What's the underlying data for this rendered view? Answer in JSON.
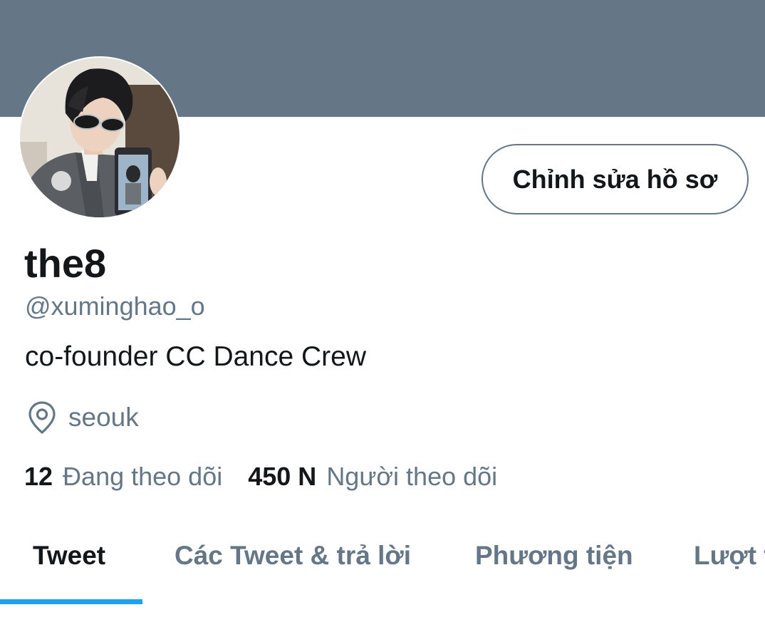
{
  "profile": {
    "display_name": "the8",
    "handle": "@xuminghao_o",
    "bio": "co-founder CC Dance Crew",
    "location": "seouk",
    "edit_button_label": "Chỉnh sửa hồ sơ"
  },
  "stats": {
    "following_count": "12",
    "following_label": "Đang theo dõi",
    "followers_count": "450 N",
    "followers_label": "Người theo dõi"
  },
  "tabs": [
    {
      "label": "Tweet",
      "active": true
    },
    {
      "label": "Các Tweet & trả lời",
      "active": false
    },
    {
      "label": "Phương tiện",
      "active": false
    },
    {
      "label": "Lượt thích",
      "active": false
    }
  ],
  "colors": {
    "banner": "#657786",
    "accent": "#1da1f2",
    "primary_text": "#14171a",
    "secondary_text": "#657786"
  },
  "icons": {
    "location": "map-pin-icon"
  }
}
